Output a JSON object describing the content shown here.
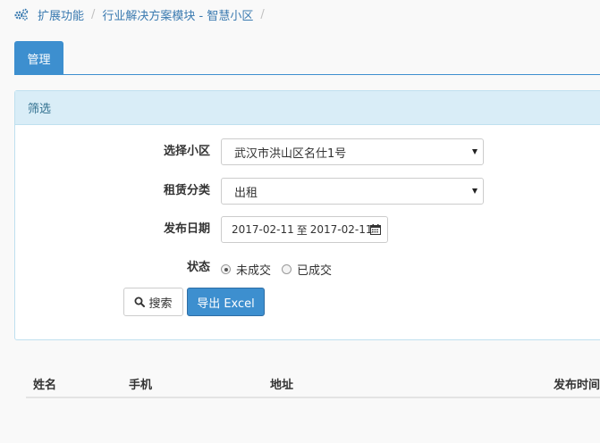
{
  "breadcrumb": {
    "items": [
      "扩展功能",
      "行业解决方案模块 - 智慧小区"
    ],
    "separator": "/"
  },
  "tabs": [
    {
      "label": "管理",
      "active": true
    }
  ],
  "filter_panel": {
    "title": "筛选",
    "fields": {
      "community": {
        "label": "选择小区",
        "value": "武汉市洪山区名仕1号"
      },
      "rental_type": {
        "label": "租赁分类",
        "value": "出租"
      },
      "publish_date": {
        "label": "发布日期",
        "start": "2017-02-11",
        "to": "至",
        "end": "2017-02-11"
      },
      "status": {
        "label": "状态",
        "options": [
          "未成交",
          "已成交"
        ],
        "selected": "未成交"
      }
    },
    "buttons": {
      "search": "搜索",
      "export": "导出 Excel"
    }
  },
  "table": {
    "columns": [
      "姓名",
      "手机",
      "地址",
      "发布时间"
    ]
  },
  "colors": {
    "primary": "#3d8fcf",
    "panel_heading_bg": "#d9edf7",
    "panel_heading_text": "#31708f",
    "link": "#3a7ab0"
  },
  "icons": {
    "breadcrumb": "gears-icon",
    "search": "search-icon",
    "calendar": "calendar-icon",
    "select": "caret-down-icon"
  }
}
